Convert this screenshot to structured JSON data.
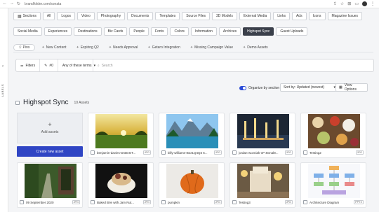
{
  "browser": {
    "url": "brandfolder.com/sonata"
  },
  "sidebar": {
    "vertical_label": "LABELS"
  },
  "sections_label": "Sections",
  "section_chips_row1": [
    "All",
    "Logos",
    "Video",
    "Photography",
    "Documents",
    "Templates",
    "Source Files",
    "3D Models",
    "External Media",
    "Links",
    "Ads",
    "Icons",
    "Magazine Issues"
  ],
  "section_chips_row2": [
    "Social Media",
    "Experiences",
    "Destinations",
    "Biz Cards",
    "People",
    "Fonts",
    "Colors",
    "Information",
    "Archives",
    "Highspot Sync",
    "Guest Uploads"
  ],
  "active_section": "Highspot Sync",
  "saved_searches": [
    "Pins",
    "New Content",
    "Expiring Q2",
    "Needs Approval",
    "Getaro Integration",
    "Missing Campaign Value",
    "Demo Assets"
  ],
  "filter_bar": {
    "filters_label": "Filters",
    "tag_label": "#0",
    "terms_select": "Any of these terms",
    "search_placeholder": "Search"
  },
  "toolbar": {
    "organize_label": "Organize by section",
    "sort_label": "Sort by: Updated (newest)",
    "view_options": "View Options"
  },
  "section": {
    "title": "Highspot Sync",
    "count": "10 Assets"
  },
  "add_card": {
    "label": "Add assets",
    "create_button": "Create new asset"
  },
  "assets": [
    {
      "name": "benjamin-davies-DnDnOT...",
      "type": "JPG"
    },
    {
      "name": "billy-williams-8wz1Q4Q3 6...",
      "type": "JPG"
    },
    {
      "name": "jordan-wozniak-xP 4Gnal8...",
      "type": "JPG"
    },
    {
      "name": "Testing2",
      "type": "JPG"
    },
    {
      "name": "09 September 2020",
      "type": "JPG"
    },
    {
      "name": "Baked Brie with Jam Nut...",
      "type": "JPG"
    },
    {
      "name": "pumpkin",
      "type": "JPG"
    },
    {
      "name": "Testing3",
      "type": "JPG"
    },
    {
      "name": "Architecture Diagram",
      "type": "PPTX"
    }
  ],
  "colors": {
    "accent": "#2f45c4",
    "active_chip": "#3a3f4a"
  },
  "icons": {
    "sections": "grid-icon",
    "pins": "pin-icon",
    "filters": "filter-icon",
    "search": "search-icon",
    "view": "view-options-icon"
  }
}
